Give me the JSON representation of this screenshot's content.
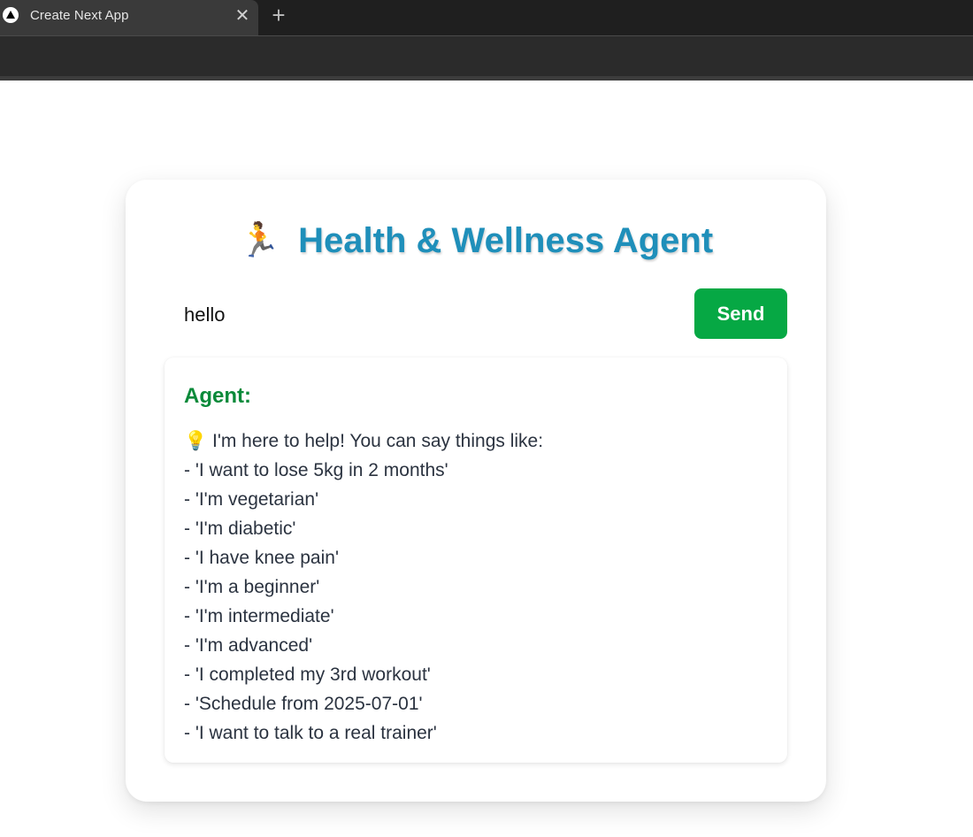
{
  "browser": {
    "tab_title": "Create Next App",
    "tab_close": "✕",
    "new_tab": "+"
  },
  "header": {
    "emoji": "🏃",
    "title": "Health & Wellness Agent"
  },
  "chat_input": {
    "value": "hello"
  },
  "send_button": {
    "label": "Send"
  },
  "response": {
    "label": "Agent:",
    "lines": [
      "💡 I'm here to help! You can say things like:",
      "- 'I want to lose 5kg in 2 months'",
      "- 'I'm vegetarian'",
      "- 'I'm diabetic'",
      "- 'I have knee pain'",
      "- 'I'm a beginner'",
      "- 'I'm intermediate'",
      "- 'I'm advanced'",
      "- 'I completed my 3rd workout'",
      "- 'Schedule from 2025-07-01'",
      "- 'I want to talk to a real trainer'"
    ]
  },
  "colors": {
    "title": "#1f8fba",
    "send_button": "#06a844",
    "agent_label": "#0a8a3a"
  }
}
